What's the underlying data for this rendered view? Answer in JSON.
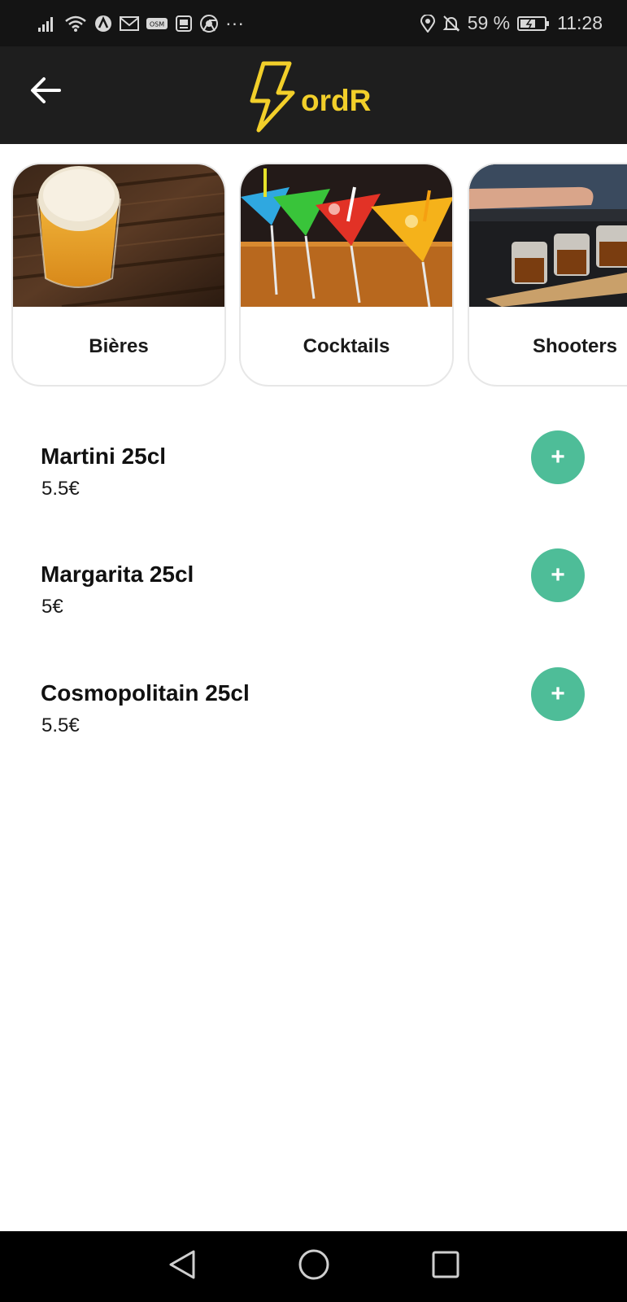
{
  "status_bar": {
    "battery_percent": "59 %",
    "time": "11:28",
    "more": "···",
    "icons": [
      "signal-icon",
      "wifi-icon",
      "vpn-icon",
      "mail-icon",
      "osm-icon",
      "picture-icon",
      "chrome-icon",
      "location-icon",
      "bell-off-icon",
      "battery-charging-icon"
    ],
    "osm_label": "OSM"
  },
  "app_bar": {
    "logo_text": "ordR",
    "brand_color": "#f2cf2a",
    "back_icon": "arrow-left-icon"
  },
  "categories": [
    {
      "label": "Bières",
      "image": "beer-photo"
    },
    {
      "label": "Cocktails",
      "image": "cocktails-photo"
    },
    {
      "label": "Shooters",
      "image": "shooters-photo"
    }
  ],
  "items": [
    {
      "name": "Martini 25cl",
      "price": "5.5€",
      "add_label": "+"
    },
    {
      "name": "Margarita 25cl",
      "price": "5€",
      "add_label": "+"
    },
    {
      "name": "Cosmopolitain 25cl",
      "price": "5.5€",
      "add_label": "+"
    }
  ],
  "accent_color": "#4ebd98",
  "nav_bar": {
    "icons": [
      "back-triangle-icon",
      "home-circle-icon",
      "recents-square-icon"
    ]
  }
}
